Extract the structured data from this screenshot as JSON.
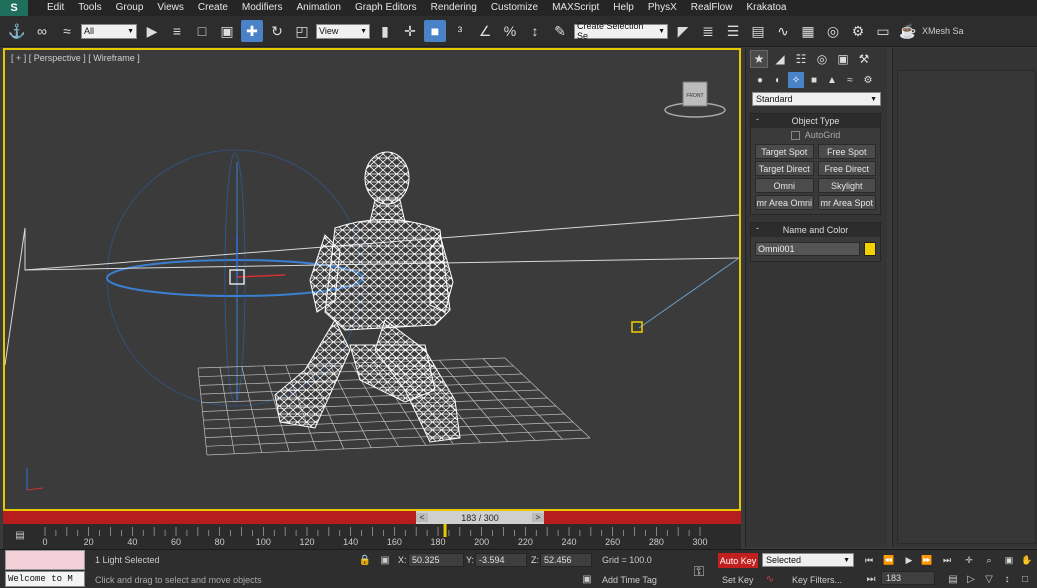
{
  "app": {
    "logo_text": "S"
  },
  "menu": [
    "Edit",
    "Tools",
    "Group",
    "Views",
    "Create",
    "Modifiers",
    "Animation",
    "Graph Editors",
    "Rendering",
    "Customize",
    "MAXScript",
    "Help",
    "PhysX",
    "RealFlow",
    "Krakatoa"
  ],
  "toolbar": {
    "selection_filter": "All",
    "ref_coord": "View",
    "named_selection": "Create Selection Se",
    "extra_label": "XMesh Sa"
  },
  "viewport": {
    "label": "[ + ] [ Perspective ] [ Wireframe ]",
    "viewcube_label": "FRONT"
  },
  "timeline": {
    "slider_label": "183 / 300",
    "prev": "<",
    "next": ">",
    "current_frame": 183,
    "total_frames": 300,
    "ticks": [
      "0",
      "20",
      "40",
      "60",
      "80",
      "100",
      "120",
      "140",
      "160",
      "180",
      "200",
      "220",
      "240",
      "260",
      "280",
      "300"
    ]
  },
  "command_panel": {
    "category": "Standard",
    "object_type_title": "Object Type",
    "autogrid_label": "AutoGrid",
    "light_buttons": [
      "Target Spot",
      "Free Spot",
      "Target Direct",
      "Free Direct",
      "Omni",
      "Skylight",
      "mr Area Omni",
      "mr Area Spot"
    ],
    "name_color_title": "Name and Color",
    "object_name": "Omni001",
    "object_color": "#f3d100"
  },
  "status": {
    "welcome": "Welcome to M",
    "selection_info": "1 Light Selected",
    "prompt": "Click and drag to select and move objects",
    "x_label": "X:",
    "x_value": "50.325",
    "y_label": "Y:",
    "y_value": "-3.594",
    "z_label": "Z:",
    "z_value": "52.456",
    "grid": "Grid = 100.0",
    "add_time_tag": "Add Time Tag",
    "auto_key": "Auto Key",
    "set_key": "Set Key",
    "selected_dropdown": "Selected",
    "key_filters": "Key Filters...",
    "frame": "183"
  },
  "colors": {
    "viewport_border": "#e8c800",
    "timebar_red": "#b71d1d",
    "auto_key_red": "#c21f1f",
    "active_blue": "#4a82c7"
  }
}
